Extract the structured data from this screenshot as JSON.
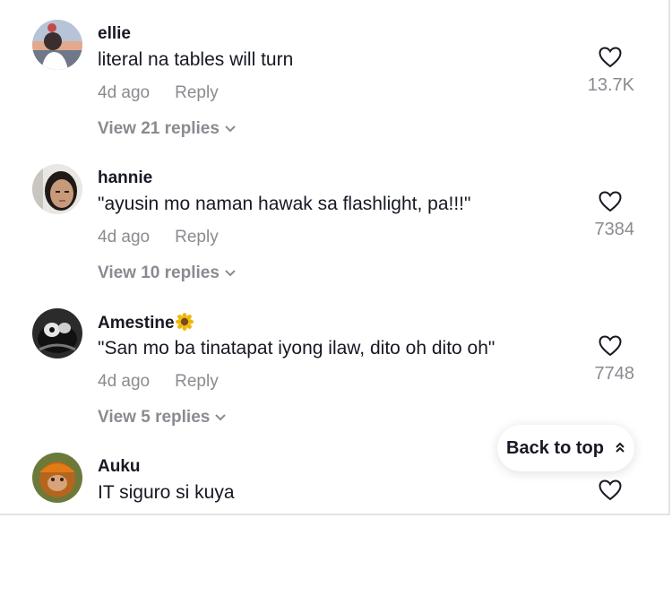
{
  "comments": [
    {
      "username": "ellie",
      "text": "literal na tables will turn",
      "age": "4d ago",
      "reply_label": "Reply",
      "likes": "13.7K",
      "view_replies": "View 21 replies"
    },
    {
      "username": "hannie",
      "text": "\"ayusin mo naman hawak sa flashlight, pa!!!\"",
      "age": "4d ago",
      "reply_label": "Reply",
      "likes": "7384",
      "view_replies": "View 10 replies"
    },
    {
      "username": "Amestine",
      "username_emoji": "sunflower-icon",
      "text": "\"San mo ba tinatapat iyong ilaw, dito oh dito oh\"",
      "age": "4d ago",
      "reply_label": "Reply",
      "likes": "7748",
      "view_replies": "View 5 replies"
    },
    {
      "username": "Auku",
      "text": "IT siguro si kuya"
    }
  ],
  "back_to_top": {
    "label": "Back to top",
    "icon": "double-chevron-up-icon"
  },
  "colors": {
    "primary_text": "#161823",
    "secondary_text": "#8a8b91",
    "background": "#ffffff"
  }
}
